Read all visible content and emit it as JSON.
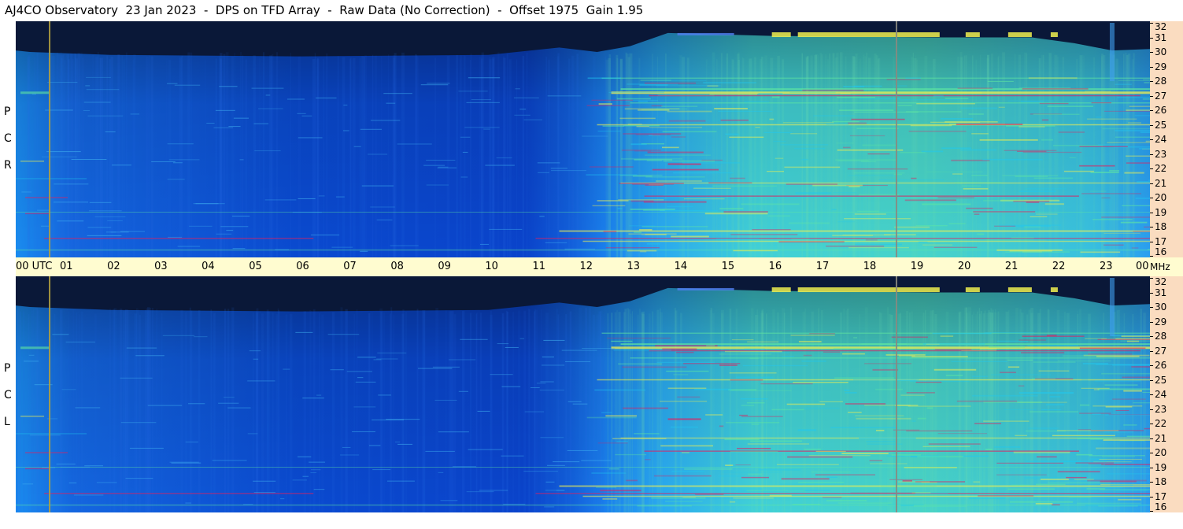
{
  "title": "AJ4CO Observatory  23 Jan 2023  -  DPS on TFD Array  -  Raw Data (No Correction)  -  Offset 1975  Gain 1.95",
  "chart_data": [
    {
      "type": "heatmap",
      "panel": "top",
      "side_label": [
        "R",
        "C",
        "P"
      ],
      "x_unit": "UTC",
      "xlim": [
        0,
        24
      ],
      "ylim": [
        16,
        32
      ],
      "y_unit": "MHz",
      "y_ticks": [
        32,
        31,
        30,
        29,
        28,
        27,
        26,
        25,
        24,
        23,
        22,
        21,
        20,
        19,
        18,
        17,
        16
      ]
    },
    {
      "type": "heatmap",
      "panel": "bottom",
      "side_label": [
        "L",
        "C",
        "P"
      ],
      "x_unit": "UTC",
      "xlim": [
        0,
        24
      ],
      "ylim": [
        16,
        32
      ],
      "y_unit": "MHz",
      "y_ticks": [
        32,
        31,
        30,
        29,
        28,
        27,
        26,
        25,
        24,
        23,
        22,
        21,
        20,
        19,
        18,
        17,
        16
      ]
    }
  ],
  "utc_axis": {
    "ticks": [
      "00",
      "01",
      "02",
      "03",
      "04",
      "05",
      "06",
      "07",
      "08",
      "09",
      "10",
      "11",
      "12",
      "13",
      "14",
      "15",
      "16",
      "17",
      "18",
      "19",
      "20",
      "21",
      "22",
      "23",
      "00"
    ],
    "first_label": "00  UTC",
    "unit": "MHz"
  },
  "colors": {
    "night": "#0a1838",
    "deep_blue": "#0a3cc8",
    "mid_blue": "#1a78f0",
    "cyan": "#20c8f0",
    "green": "#60e8a0",
    "yellow": "#f0f050",
    "red": "#e02060",
    "utc_bar": "#fffcd0",
    "mhz_bar": "#fadcc0"
  }
}
